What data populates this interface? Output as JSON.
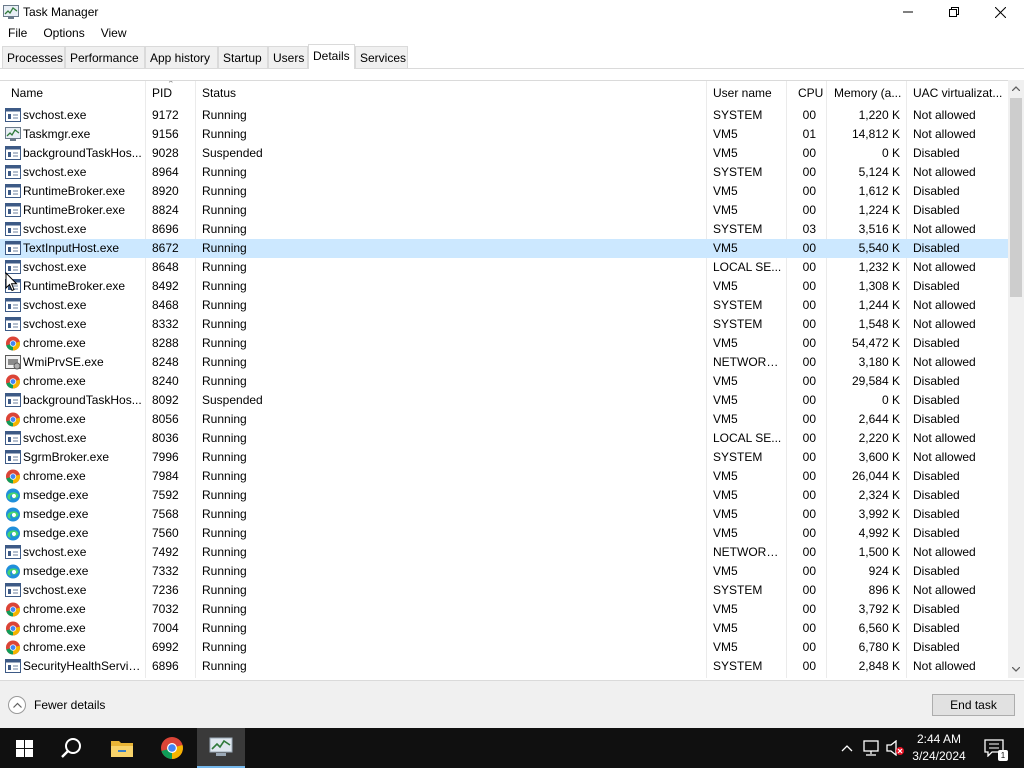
{
  "window": {
    "title": "Task Manager",
    "controls": {
      "minimize": "minimize-icon",
      "maximize": "restore-icon",
      "close": "close-icon"
    }
  },
  "menu": [
    "File",
    "Options",
    "View"
  ],
  "tabs": [
    {
      "label": "Processes",
      "active": false
    },
    {
      "label": "Performance",
      "active": false
    },
    {
      "label": "App history",
      "active": false
    },
    {
      "label": "Startup",
      "active": false
    },
    {
      "label": "Users",
      "active": false
    },
    {
      "label": "Details",
      "active": true
    },
    {
      "label": "Services",
      "active": false
    }
  ],
  "table": {
    "columns": [
      "Name",
      "PID",
      "Status",
      "User name",
      "CPU",
      "Memory (a...",
      "UAC virtualizat..."
    ],
    "selected_index": 7,
    "rows": [
      {
        "icon": "svc",
        "name": "svchost.exe",
        "pid": "9172",
        "status": "Running",
        "user": "SYSTEM",
        "cpu": "00",
        "mem": "1,220 K",
        "uac": "Not allowed"
      },
      {
        "icon": "tm",
        "name": "Taskmgr.exe",
        "pid": "9156",
        "status": "Running",
        "user": "VM5",
        "cpu": "01",
        "mem": "14,812 K",
        "uac": "Not allowed"
      },
      {
        "icon": "svc",
        "name": "backgroundTaskHos...",
        "pid": "9028",
        "status": "Suspended",
        "user": "VM5",
        "cpu": "00",
        "mem": "0 K",
        "uac": "Disabled"
      },
      {
        "icon": "svc",
        "name": "svchost.exe",
        "pid": "8964",
        "status": "Running",
        "user": "SYSTEM",
        "cpu": "00",
        "mem": "5,124 K",
        "uac": "Not allowed"
      },
      {
        "icon": "svc",
        "name": "RuntimeBroker.exe",
        "pid": "8920",
        "status": "Running",
        "user": "VM5",
        "cpu": "00",
        "mem": "1,612 K",
        "uac": "Disabled"
      },
      {
        "icon": "svc",
        "name": "RuntimeBroker.exe",
        "pid": "8824",
        "status": "Running",
        "user": "VM5",
        "cpu": "00",
        "mem": "1,224 K",
        "uac": "Disabled"
      },
      {
        "icon": "svc",
        "name": "svchost.exe",
        "pid": "8696",
        "status": "Running",
        "user": "SYSTEM",
        "cpu": "03",
        "mem": "3,516 K",
        "uac": "Not allowed"
      },
      {
        "icon": "svc",
        "name": "TextInputHost.exe",
        "pid": "8672",
        "status": "Running",
        "user": "VM5",
        "cpu": "00",
        "mem": "5,540 K",
        "uac": "Disabled"
      },
      {
        "icon": "svc",
        "name": "svchost.exe",
        "pid": "8648",
        "status": "Running",
        "user": "LOCAL SE...",
        "cpu": "00",
        "mem": "1,232 K",
        "uac": "Not allowed"
      },
      {
        "icon": "svc",
        "name": "RuntimeBroker.exe",
        "pid": "8492",
        "status": "Running",
        "user": "VM5",
        "cpu": "00",
        "mem": "1,308 K",
        "uac": "Disabled"
      },
      {
        "icon": "svc",
        "name": "svchost.exe",
        "pid": "8468",
        "status": "Running",
        "user": "SYSTEM",
        "cpu": "00",
        "mem": "1,244 K",
        "uac": "Not allowed"
      },
      {
        "icon": "svc",
        "name": "svchost.exe",
        "pid": "8332",
        "status": "Running",
        "user": "SYSTEM",
        "cpu": "00",
        "mem": "1,548 K",
        "uac": "Not allowed"
      },
      {
        "icon": "chrome",
        "name": "chrome.exe",
        "pid": "8288",
        "status": "Running",
        "user": "VM5",
        "cpu": "00",
        "mem": "54,472 K",
        "uac": "Disabled"
      },
      {
        "icon": "wmi",
        "name": "WmiPrvSE.exe",
        "pid": "8248",
        "status": "Running",
        "user": "NETWORK...",
        "cpu": "00",
        "mem": "3,180 K",
        "uac": "Not allowed"
      },
      {
        "icon": "chrome",
        "name": "chrome.exe",
        "pid": "8240",
        "status": "Running",
        "user": "VM5",
        "cpu": "00",
        "mem": "29,584 K",
        "uac": "Disabled"
      },
      {
        "icon": "svc",
        "name": "backgroundTaskHos...",
        "pid": "8092",
        "status": "Suspended",
        "user": "VM5",
        "cpu": "00",
        "mem": "0 K",
        "uac": "Disabled"
      },
      {
        "icon": "chrome",
        "name": "chrome.exe",
        "pid": "8056",
        "status": "Running",
        "user": "VM5",
        "cpu": "00",
        "mem": "2,644 K",
        "uac": "Disabled"
      },
      {
        "icon": "svc",
        "name": "svchost.exe",
        "pid": "8036",
        "status": "Running",
        "user": "LOCAL SE...",
        "cpu": "00",
        "mem": "2,220 K",
        "uac": "Not allowed"
      },
      {
        "icon": "svc",
        "name": "SgrmBroker.exe",
        "pid": "7996",
        "status": "Running",
        "user": "SYSTEM",
        "cpu": "00",
        "mem": "3,600 K",
        "uac": "Not allowed"
      },
      {
        "icon": "chrome",
        "name": "chrome.exe",
        "pid": "7984",
        "status": "Running",
        "user": "VM5",
        "cpu": "00",
        "mem": "26,044 K",
        "uac": "Disabled"
      },
      {
        "icon": "edge",
        "name": "msedge.exe",
        "pid": "7592",
        "status": "Running",
        "user": "VM5",
        "cpu": "00",
        "mem": "2,324 K",
        "uac": "Disabled"
      },
      {
        "icon": "edge",
        "name": "msedge.exe",
        "pid": "7568",
        "status": "Running",
        "user": "VM5",
        "cpu": "00",
        "mem": "3,992 K",
        "uac": "Disabled"
      },
      {
        "icon": "edge",
        "name": "msedge.exe",
        "pid": "7560",
        "status": "Running",
        "user": "VM5",
        "cpu": "00",
        "mem": "4,992 K",
        "uac": "Disabled"
      },
      {
        "icon": "svc",
        "name": "svchost.exe",
        "pid": "7492",
        "status": "Running",
        "user": "NETWORK...",
        "cpu": "00",
        "mem": "1,500 K",
        "uac": "Not allowed"
      },
      {
        "icon": "edge",
        "name": "msedge.exe",
        "pid": "7332",
        "status": "Running",
        "user": "VM5",
        "cpu": "00",
        "mem": "924 K",
        "uac": "Disabled"
      },
      {
        "icon": "svc",
        "name": "svchost.exe",
        "pid": "7236",
        "status": "Running",
        "user": "SYSTEM",
        "cpu": "00",
        "mem": "896 K",
        "uac": "Not allowed"
      },
      {
        "icon": "chrome",
        "name": "chrome.exe",
        "pid": "7032",
        "status": "Running",
        "user": "VM5",
        "cpu": "00",
        "mem": "3,792 K",
        "uac": "Disabled"
      },
      {
        "icon": "chrome",
        "name": "chrome.exe",
        "pid": "7004",
        "status": "Running",
        "user": "VM5",
        "cpu": "00",
        "mem": "6,560 K",
        "uac": "Disabled"
      },
      {
        "icon": "chrome",
        "name": "chrome.exe",
        "pid": "6992",
        "status": "Running",
        "user": "VM5",
        "cpu": "00",
        "mem": "6,780 K",
        "uac": "Disabled"
      },
      {
        "icon": "svc",
        "name": "SecurityHealthServic...",
        "pid": "6896",
        "status": "Running",
        "user": "SYSTEM",
        "cpu": "00",
        "mem": "2,848 K",
        "uac": "Not allowed"
      }
    ]
  },
  "footer": {
    "fewer_details": "Fewer details",
    "end_task": "End task"
  },
  "taskbar": {
    "time": "2:44 AM",
    "date": "3/24/2024",
    "notification_count": "1",
    "pinned": [
      "windows-start-icon",
      "search-icon",
      "file-explorer-icon",
      "chrome-icon",
      "task-manager-icon"
    ]
  },
  "colors": {
    "selection": "#cce8ff",
    "taskbar": "#101010",
    "accent": "#76b9ed"
  }
}
